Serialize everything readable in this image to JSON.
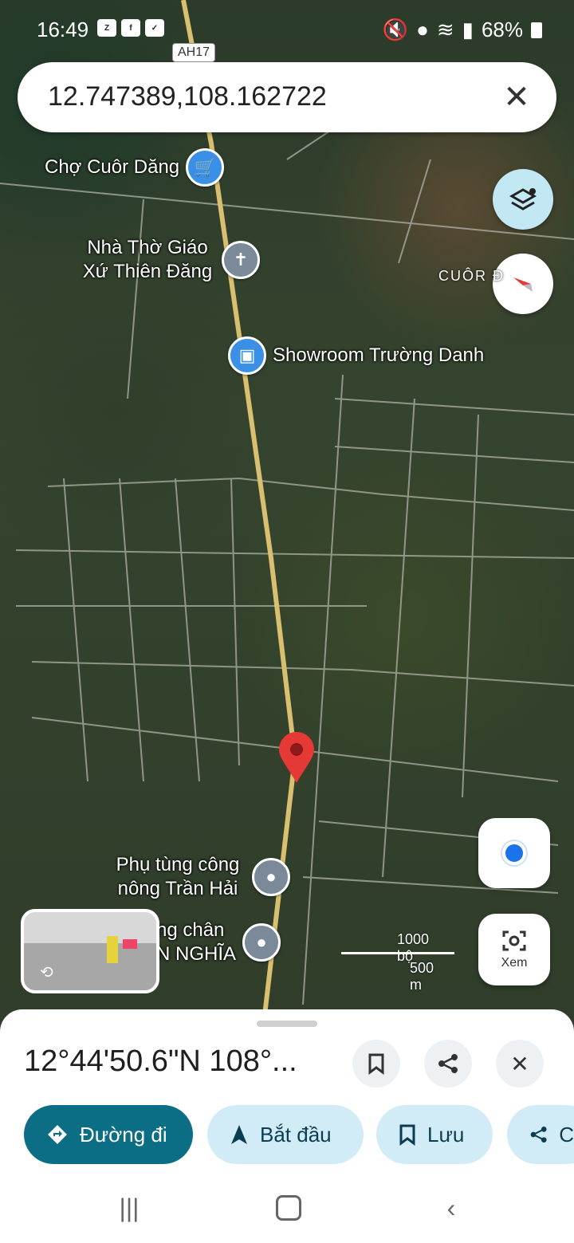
{
  "status": {
    "time": "16:49",
    "battery": "68%"
  },
  "map_labels": {
    "highway": "AH17",
    "area": "CUÔR Đ"
  },
  "search": {
    "value": "12.747389,108.162722"
  },
  "pois": [
    {
      "label": "Chợ Cuôr Dăng",
      "icon": "cart-icon"
    },
    {
      "label": "Nhà Thờ Giáo Xứ Thiên Đăng",
      "icon": "church-icon"
    },
    {
      "label": "Showroom Trường Danh",
      "icon": "shopping-bag-icon"
    },
    {
      "label": "Phụ tùng công nông Trần Hải",
      "icon": "place-icon"
    },
    {
      "label": "ng chân\nN NGHĨA",
      "icon": "place-icon"
    }
  ],
  "scale": {
    "top": "1000 bộ",
    "bottom": "500 m"
  },
  "lens": {
    "label": "Xem"
  },
  "sheet": {
    "title": "12°44'50.6\"N 108°...",
    "chips": {
      "directions": "Đường đi",
      "start": "Bắt đầu",
      "save": "Lưu",
      "share": "C"
    }
  },
  "colors": {
    "accent": "#0b6e84",
    "chip": "#d2ecf7",
    "pin": "#e53935"
  }
}
